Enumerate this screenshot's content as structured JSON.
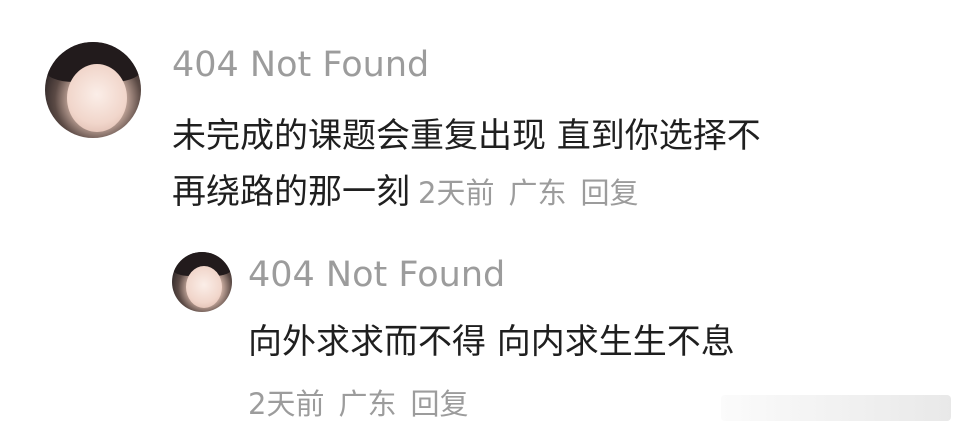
{
  "comment": {
    "user_name": "404 Not Found",
    "text_line1": "未完成的课题会重复出现 直到你选择不",
    "text_line2": "再绕路的那一刻",
    "time": "2天前",
    "location": "广东",
    "reply_label": "回复"
  },
  "reply": {
    "user_name": "404 Not Found",
    "text": "向外求求而不得 向内求生生不息",
    "time": "2天前",
    "location": "广东",
    "reply_label": "回复"
  }
}
